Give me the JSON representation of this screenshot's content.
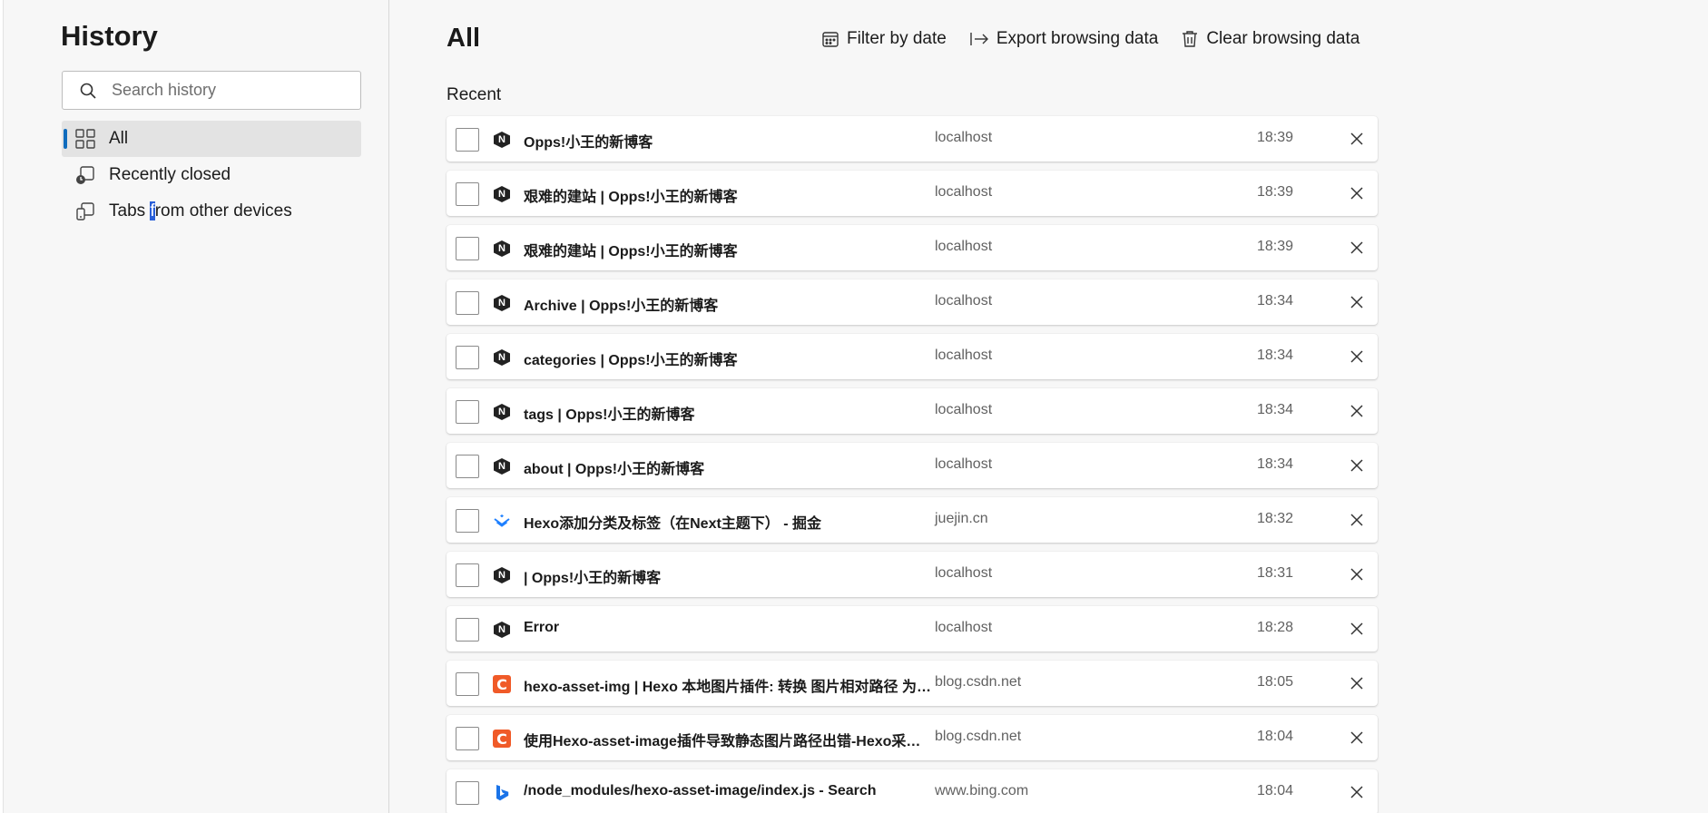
{
  "sidebar": {
    "title": "History",
    "search_placeholder": "Search history",
    "nav": [
      {
        "label": "All",
        "icon": "grid-icon",
        "active": true
      },
      {
        "label": "Recently closed",
        "icon": "recently-closed-icon",
        "active": false
      },
      {
        "label_before": "Tabs ",
        "label_sel": "f",
        "label_after": "rom other devices",
        "icon": "devices-icon",
        "active": false
      }
    ]
  },
  "main": {
    "title": "All",
    "toolbar": {
      "filter_label": "Filter by date",
      "export_label": "Export browsing data",
      "clear_label": "Clear browsing data"
    },
    "section_label": "Recent",
    "rows": [
      {
        "title": "Opps!小王的新博客",
        "domain": "localhost",
        "time": "18:39",
        "favicon": "next-n"
      },
      {
        "title": "艰难的建站 | Opps!小王的新博客",
        "domain": "localhost",
        "time": "18:39",
        "favicon": "next-n"
      },
      {
        "title": "艰难的建站 | Opps!小王的新博客",
        "domain": "localhost",
        "time": "18:39",
        "favicon": "next-n"
      },
      {
        "title": "Archive | Opps!小王的新博客",
        "domain": "localhost",
        "time": "18:34",
        "favicon": "next-n"
      },
      {
        "title": "categories | Opps!小王的新博客",
        "domain": "localhost",
        "time": "18:34",
        "favicon": "next-n"
      },
      {
        "title": "tags | Opps!小王的新博客",
        "domain": "localhost",
        "time": "18:34",
        "favicon": "next-n"
      },
      {
        "title": "about | Opps!小王的新博客",
        "domain": "localhost",
        "time": "18:34",
        "favicon": "next-n"
      },
      {
        "title": "Hexo添加分类及标签（在Next主题下） - 掘金",
        "domain": "juejin.cn",
        "time": "18:32",
        "favicon": "juejin"
      },
      {
        "title": "| Opps!小王的新博客",
        "domain": "localhost",
        "time": "18:31",
        "favicon": "next-n"
      },
      {
        "title": "Error",
        "domain": "localhost",
        "time": "18:28",
        "favicon": "next-n"
      },
      {
        "title": "hexo-asset-img | Hexo 本地图片插件: 转换 图片相对路径 为 a...",
        "domain": "blog.csdn.net",
        "time": "18:05",
        "favicon": "csdn"
      },
      {
        "title": "使用Hexo-asset-image插件导致静态图片路径出错-Hexo采坑(...",
        "domain": "blog.csdn.net",
        "time": "18:04",
        "favicon": "csdn"
      },
      {
        "title": "/node_modules/hexo-asset-image/index.js - Search",
        "domain": "www.bing.com",
        "time": "18:04",
        "favicon": "bing"
      }
    ]
  },
  "colors": {
    "accent": "#0f6cbd",
    "csdn": "#f05a28",
    "bing": "#1a73e8"
  }
}
